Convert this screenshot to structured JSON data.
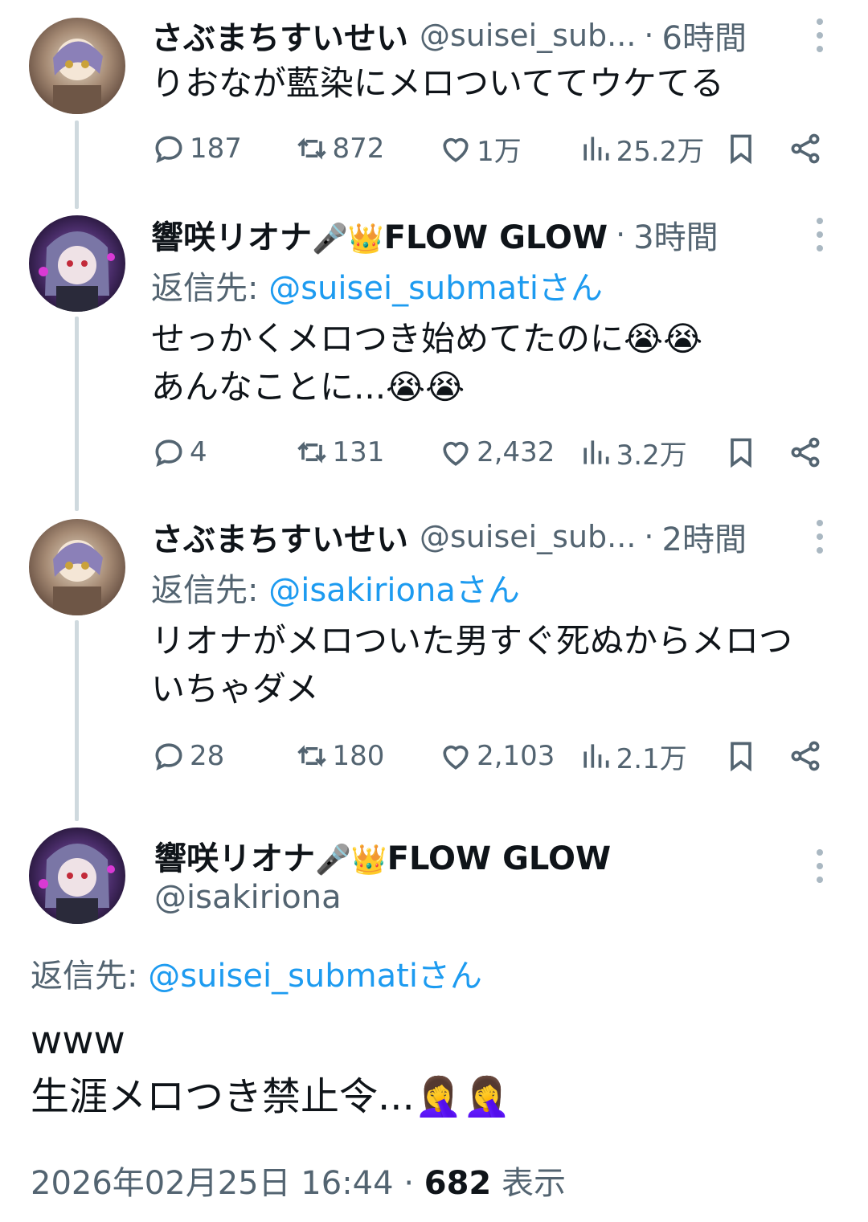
{
  "tweets": [
    {
      "name": "さぶまちすいせい",
      "name_emoji": "",
      "handle": "@suisei_sub...",
      "time": "6時間",
      "reply_to_prefix": "",
      "reply_to_mention": "",
      "lines": [
        "りおなが藍染にメロついててウケてる"
      ],
      "stats": {
        "replies": "187",
        "retweets": "872",
        "likes": "1万",
        "views": "25.2万"
      }
    },
    {
      "name": "響咲リオナ",
      "name_emoji": "🎤👑",
      "name_suffix": "FLOW GLOW",
      "handle": "",
      "time": "3時間",
      "reply_to_prefix": "返信先: ",
      "reply_to_mention": "@suisei_submatiさん",
      "lines": [
        "せっかくメロつき始めてたのに😭😭",
        "あんなことに...😭😭"
      ],
      "stats": {
        "replies": "4",
        "retweets": "131",
        "likes": "2,432",
        "views": "3.2万"
      }
    },
    {
      "name": "さぶまちすいせい",
      "name_emoji": "",
      "handle": "@suisei_sub...",
      "time": "2時間",
      "reply_to_prefix": "返信先: ",
      "reply_to_mention": "@isakirionaさん",
      "lines": [
        "リオナがメロついた男すぐ死ぬからメロつ",
        "いちゃダメ"
      ],
      "stats": {
        "replies": "28",
        "retweets": "180",
        "likes": "2,103",
        "views": "2.1万"
      }
    }
  ],
  "main_tweet": {
    "name": "響咲リオナ",
    "name_emoji": "🎤👑",
    "name_suffix": "FLOW GLOW",
    "handle": "@isakiriona",
    "reply_to_prefix": "返信先: ",
    "reply_to_mention": "@suisei_submatiさん",
    "lines": [
      "www",
      "生涯メロつき禁止令...🤦‍♀️🤦‍♀️"
    ],
    "timestamp": "2026年02月25日 16:44",
    "separator": "·",
    "views_count": "682",
    "views_label": "表示"
  },
  "colors": {
    "link": "#1d9bf0",
    "secondary": "#536471",
    "thread_line": "#cfd9de"
  },
  "icons": [
    "reply-icon",
    "retweet-icon",
    "like-icon",
    "views-icon",
    "bookmark-icon",
    "share-icon",
    "more-icon"
  ]
}
